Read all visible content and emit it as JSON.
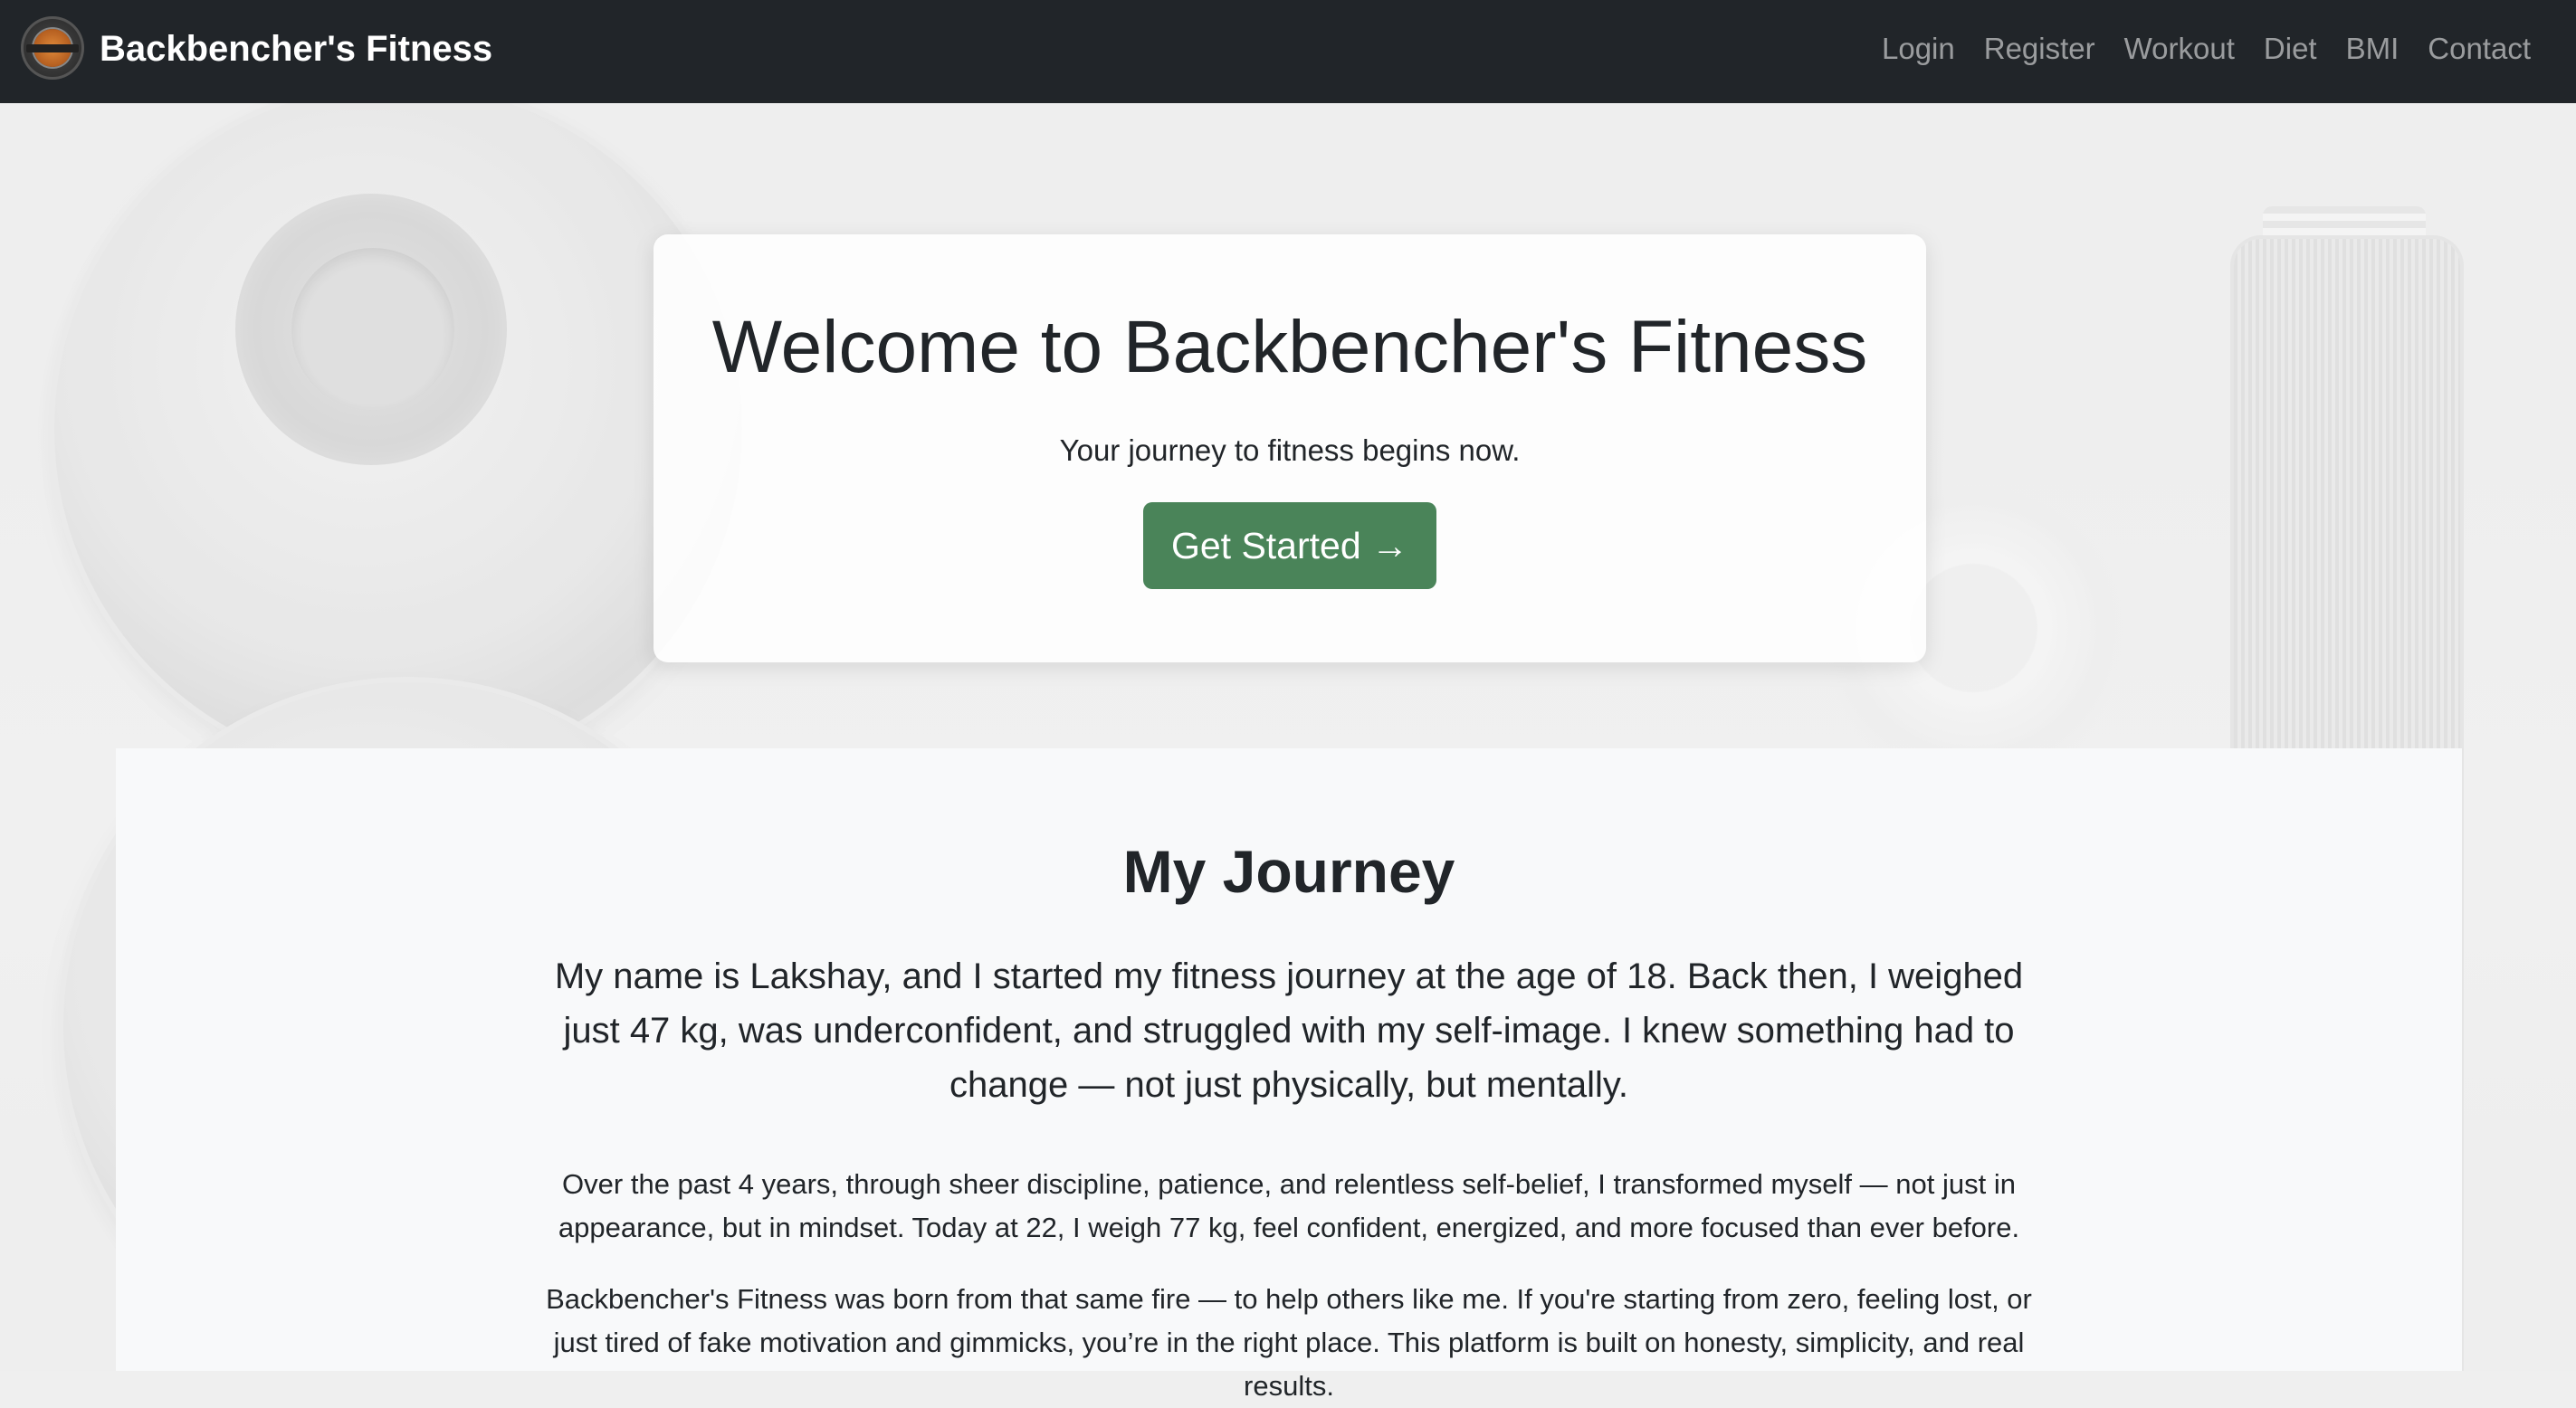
{
  "navbar": {
    "brand_title": "Backbencher's Fitness",
    "logo_icon": "backbenchers-logo",
    "links": [
      "Login",
      "Register",
      "Workout",
      "Diet",
      "BMI",
      "Contact"
    ]
  },
  "hero": {
    "title": "Welcome to Backbencher's Fitness",
    "subtitle": "Your journey to fitness begins now.",
    "cta_label": "Get Started →",
    "cta_color": "#4a8459"
  },
  "journey": {
    "title": "My Journey",
    "lead": "My name is Lakshay, and I started my fitness journey at the age of 18. Back then, I weighed just 47 kg, was underconfident, and struggled with my self-image. I knew something had to change — not just physically, but mentally.",
    "paragraph_1": "Over the past 4 years, through sheer discipline, patience, and relentless self-belief, I transformed myself — not just in appearance, but in mindset. Today at 22, I weigh 77 kg, feel confident, energized, and more focused than ever before.",
    "paragraph_2": "Backbencher's Fitness was born from that same fire — to help others like me. If you're starting from zero, feeling lost, or just tired of fake motivation and gimmicks, you’re in the right place. This platform is built on honesty, simplicity, and real results."
  },
  "colors": {
    "navbar_bg": "#212529",
    "section_bg": "#f8f9fa",
    "accent": "#4a8459"
  }
}
